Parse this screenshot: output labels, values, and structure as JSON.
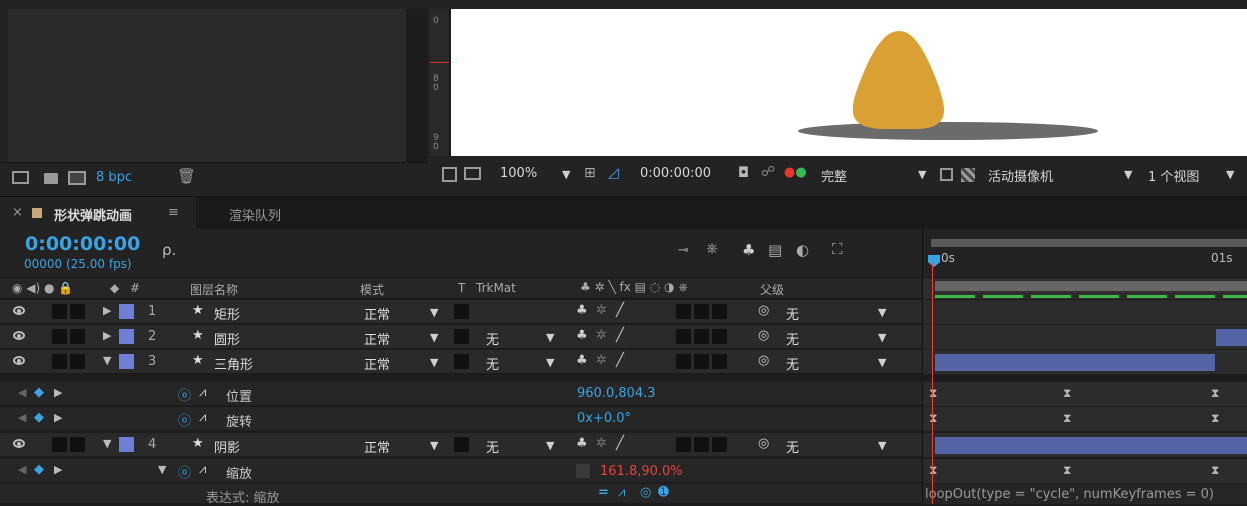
{
  "project_panel": {
    "bpc": "8 bpc"
  },
  "comp_panel": {
    "zoom": "100%",
    "timecode": "0:00:00:00",
    "quality": "完整",
    "camera": "活动摄像机",
    "views": "1 个视图",
    "ruler_marks": [
      "0",
      "8\n0",
      "9\n0"
    ],
    "shape_color": "#dba033",
    "shadow_color": "#6b6b6b"
  },
  "tabs": {
    "comp_tab": "形状弹跳动画",
    "menu": "≡",
    "render_tab": "渲染队列"
  },
  "header": {
    "timecode": "0:00:00:00",
    "frames": "00000 (25.00 fps)",
    "search_placeholder": "ρ."
  },
  "columns": {
    "num": "#",
    "layer_name": "图层名称",
    "mode": "模式",
    "t": "T",
    "trkmat": "TrkMat",
    "parent": "父级"
  },
  "ruler": {
    "t0": "0s",
    "t1": "01s"
  },
  "layers": [
    {
      "num": "1",
      "name": "矩形",
      "mode": "正常",
      "trkmat": "",
      "parent": "无"
    },
    {
      "num": "2",
      "name": "圆形",
      "mode": "正常",
      "trkmat": "无",
      "parent": "无"
    },
    {
      "num": "3",
      "name": "三角形",
      "mode": "正常",
      "trkmat": "无",
      "parent": "无"
    },
    {
      "num": "4",
      "name": "阴影",
      "mode": "正常",
      "trkmat": "无",
      "parent": "无"
    }
  ],
  "props": {
    "position": {
      "name": "位置",
      "value": "960.0,804.3"
    },
    "rotation": {
      "name": "旋转",
      "value": "0x+0.0°"
    },
    "scale": {
      "name": "缩放",
      "value": "161.8,90.0%"
    },
    "expr_label": "表达式: 缩放",
    "expression": "loopOut(type = \"cycle\", numKeyframes = 0)"
  }
}
